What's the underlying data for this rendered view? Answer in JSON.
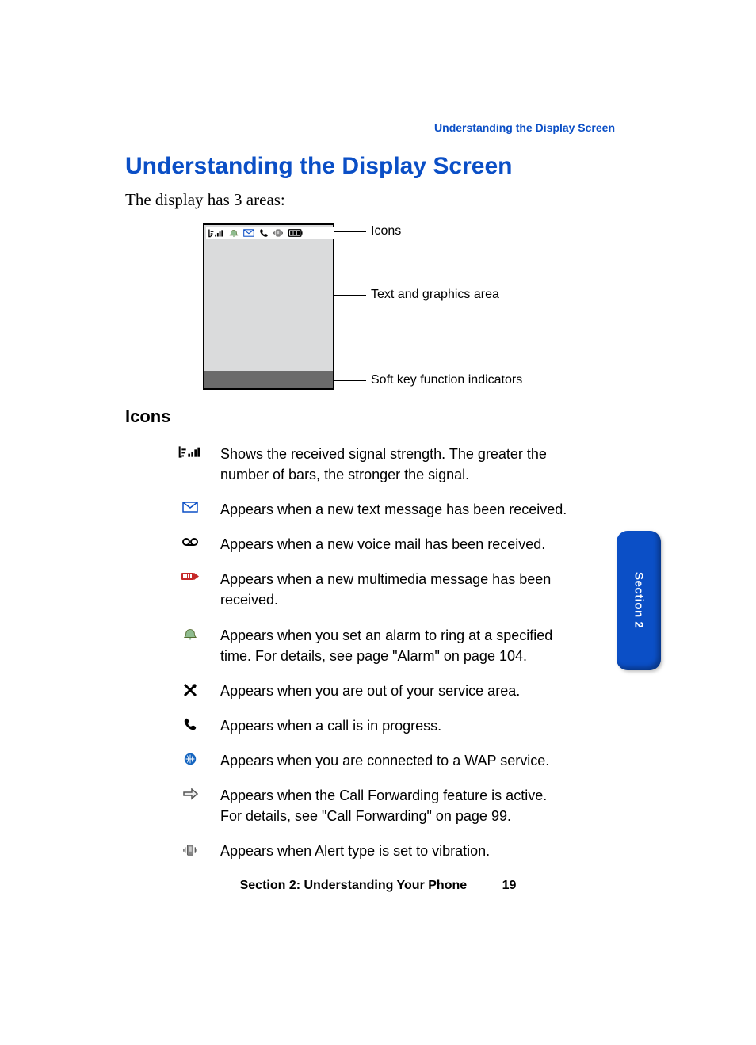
{
  "runningHeader": "Understanding the Display Screen",
  "title": "Understanding the Display Screen",
  "intro": "The display has 3 areas:",
  "diagramLabels": {
    "icons": "Icons",
    "textArea": "Text and graphics area",
    "softKey": "Soft key function indicators"
  },
  "iconsHeading": "Icons",
  "iconList": [
    {
      "icon": "signal-strength-icon",
      "desc": "Shows the received signal strength. The greater the number of bars, the stronger the signal."
    },
    {
      "icon": "text-message-icon",
      "desc": "Appears when a new text message has been received."
    },
    {
      "icon": "voicemail-icon",
      "desc": "Appears when a new voice mail has been received."
    },
    {
      "icon": "multimedia-message-icon",
      "desc": "Appears when a new multimedia message has been received."
    },
    {
      "icon": "alarm-icon",
      "desc": "Appears when you set an alarm to ring at a specified time. For details, see page \"Alarm\" on page 104."
    },
    {
      "icon": "no-service-icon",
      "desc": "Appears when you are out of your service area."
    },
    {
      "icon": "call-in-progress-icon",
      "desc": "Appears when a call is in progress."
    },
    {
      "icon": "wap-service-icon",
      "desc": "Appears when you are connected to a WAP service."
    },
    {
      "icon": "call-forwarding-icon",
      "desc": "Appears when the Call Forwarding feature is active. For details, see \"Call Forwarding\" on page 99."
    },
    {
      "icon": "vibration-icon",
      "desc": "Appears when Alert type is set to vibration."
    }
  ],
  "sectionTab": "Section 2",
  "footer": {
    "section": "Section 2: Understanding Your Phone",
    "page": "19"
  }
}
